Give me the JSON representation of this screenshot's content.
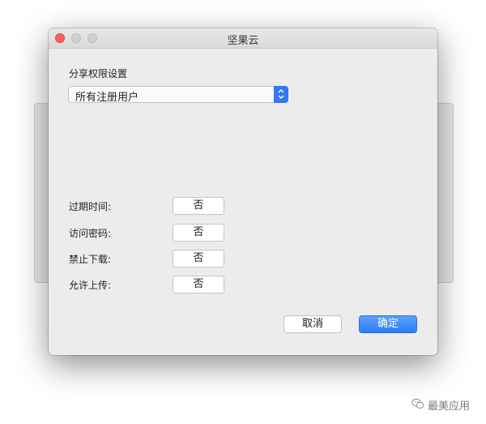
{
  "window": {
    "title": "坚果云"
  },
  "share": {
    "section_label": "分享权限设置",
    "selected_option": "所有注册用户"
  },
  "fields": [
    {
      "label": "过期时间:",
      "value": "否"
    },
    {
      "label": "访问密码:",
      "value": "否"
    },
    {
      "label": "禁止下载:",
      "value": "否"
    },
    {
      "label": "允许上传:",
      "value": "否"
    }
  ],
  "buttons": {
    "cancel": "取消",
    "ok": "确定"
  },
  "watermark": {
    "text": "最美应用"
  },
  "colors": {
    "accent": "#3478f6",
    "close_button": "#fc605c"
  },
  "icons": {
    "popup_arrow": "chevron-up-down-icon",
    "watermark": "wechat-icon"
  }
}
